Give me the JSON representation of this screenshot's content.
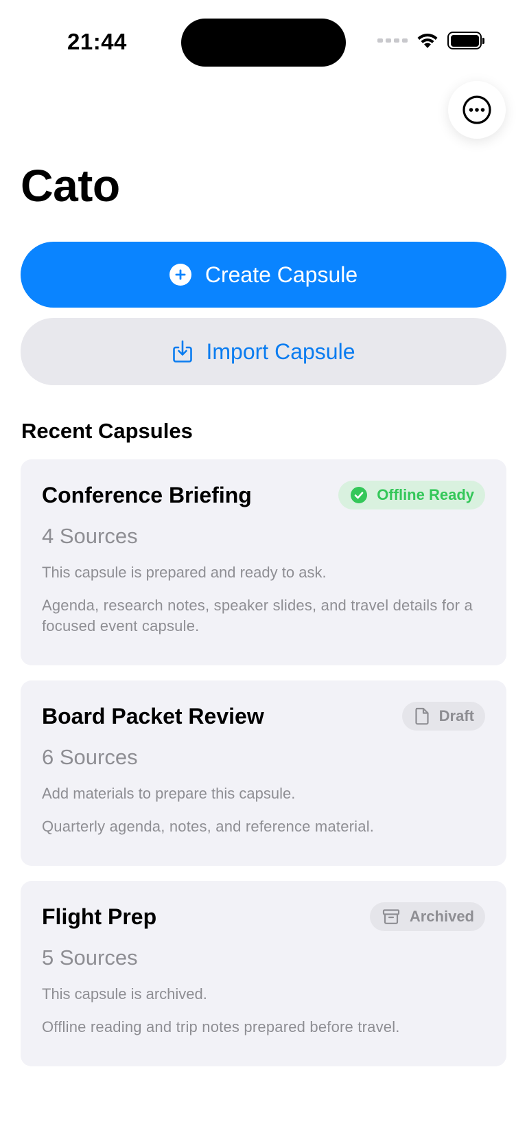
{
  "status_bar": {
    "time": "21:44"
  },
  "header": {
    "title": "Cato",
    "more_icon": "ellipsis-circle-icon"
  },
  "actions": {
    "create_label": "Create Capsule",
    "create_icon": "plus-circle-icon",
    "import_label": "Import Capsule",
    "import_icon": "import-tray-icon"
  },
  "recent": {
    "section_title": "Recent Capsules",
    "capsules": [
      {
        "title": "Conference Briefing",
        "badge": "Offline Ready",
        "badge_icon": "checkmark-circle-icon",
        "sources": "4 Sources",
        "status": "This capsule is prepared and ready to ask.",
        "description": "Agenda, research notes, speaker slides, and travel details for a focused event capsule."
      },
      {
        "title": "Board Packet Review",
        "badge": "Draft",
        "badge_icon": "document-icon",
        "sources": "6 Sources",
        "status": "Add materials to prepare this capsule.",
        "description": "Quarterly agenda, notes, and reference material."
      },
      {
        "title": "Flight Prep",
        "badge": "Archived",
        "badge_icon": "archive-box-icon",
        "sources": "5 Sources",
        "status": "This capsule is archived.",
        "description": "Offline reading and trip notes prepared before travel."
      }
    ]
  },
  "colors": {
    "accent": "#0a84ff",
    "ready_green": "#34c759",
    "secondary_text": "#8e8e93",
    "card_bg": "#f2f2f7"
  }
}
